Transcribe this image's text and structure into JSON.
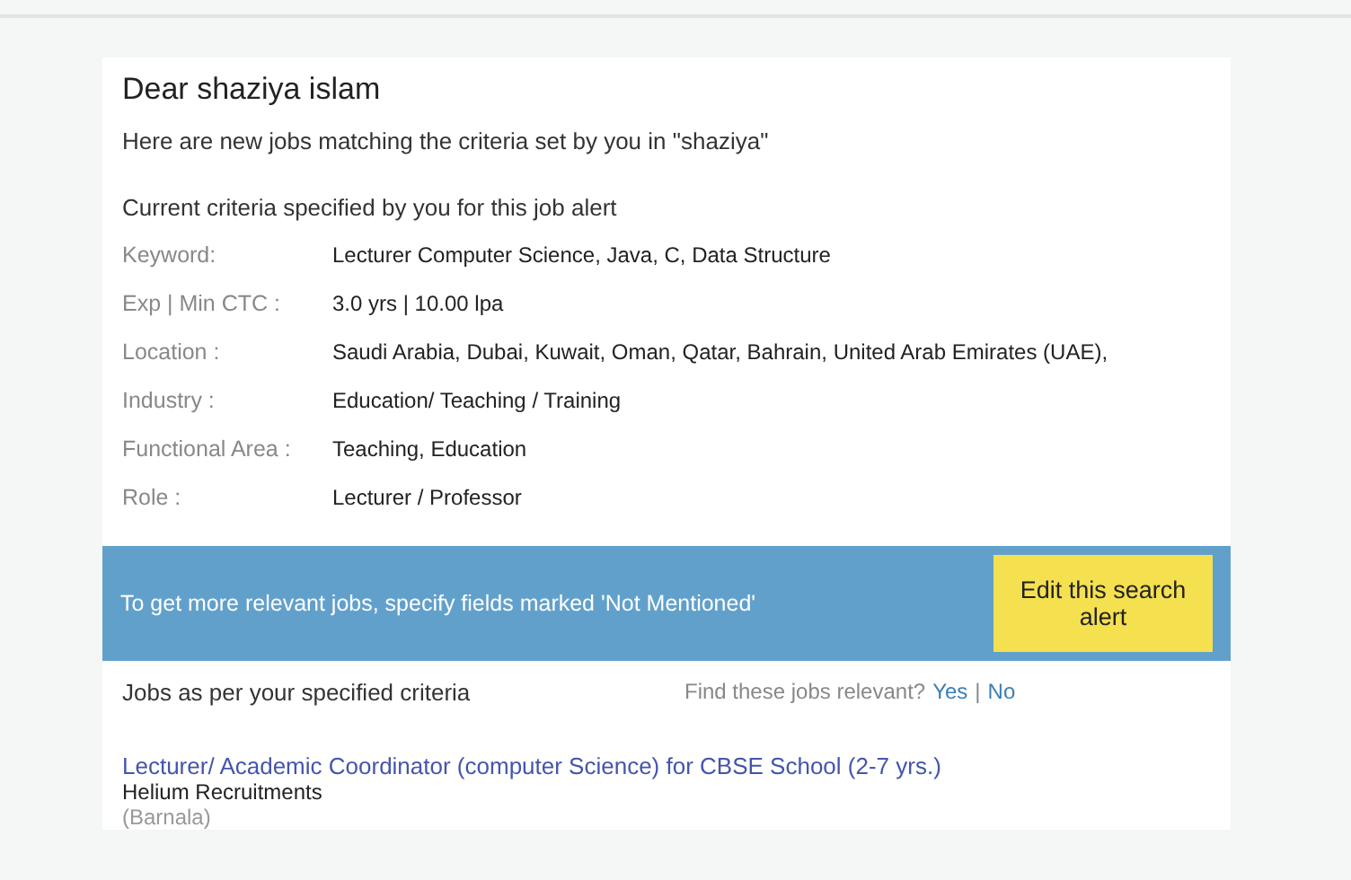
{
  "greeting": "Dear shaziya islam",
  "intro": "Here are new jobs matching the criteria set by you in \"shaziya\"",
  "criteria_heading": "Current criteria specified by you for this job alert",
  "criteria": [
    {
      "label": "Keyword:",
      "value": "Lecturer Computer Science, Java, C, Data Structure"
    },
    {
      "label": "Exp | Min CTC :",
      "value": "3.0 yrs | 10.00 lpa"
    },
    {
      "label": "Location :",
      "value": "Saudi Arabia, Dubai, Kuwait, Oman, Qatar, Bahrain, United Arab Emirates (UAE),"
    },
    {
      "label": "Industry :",
      "value": "Education/ Teaching / Training"
    },
    {
      "label": "Functional Area :",
      "value": "Teaching, Education"
    },
    {
      "label": "Role :",
      "value": "Lecturer / Professor"
    }
  ],
  "banner": {
    "text": "To get more relevant jobs, specify fields marked 'Not Mentioned'",
    "button": "Edit this search alert"
  },
  "jobs_heading": "Jobs as per your specified criteria",
  "feedback": {
    "question": "Find these jobs relevant?",
    "yes": "Yes",
    "separator": "|",
    "no": "No"
  },
  "jobs": [
    {
      "title": "Lecturer/ Academic Coordinator (computer Science) for CBSE School (2-7 yrs.)",
      "company": "Helium Recruitments",
      "location": "(Barnala)"
    }
  ]
}
